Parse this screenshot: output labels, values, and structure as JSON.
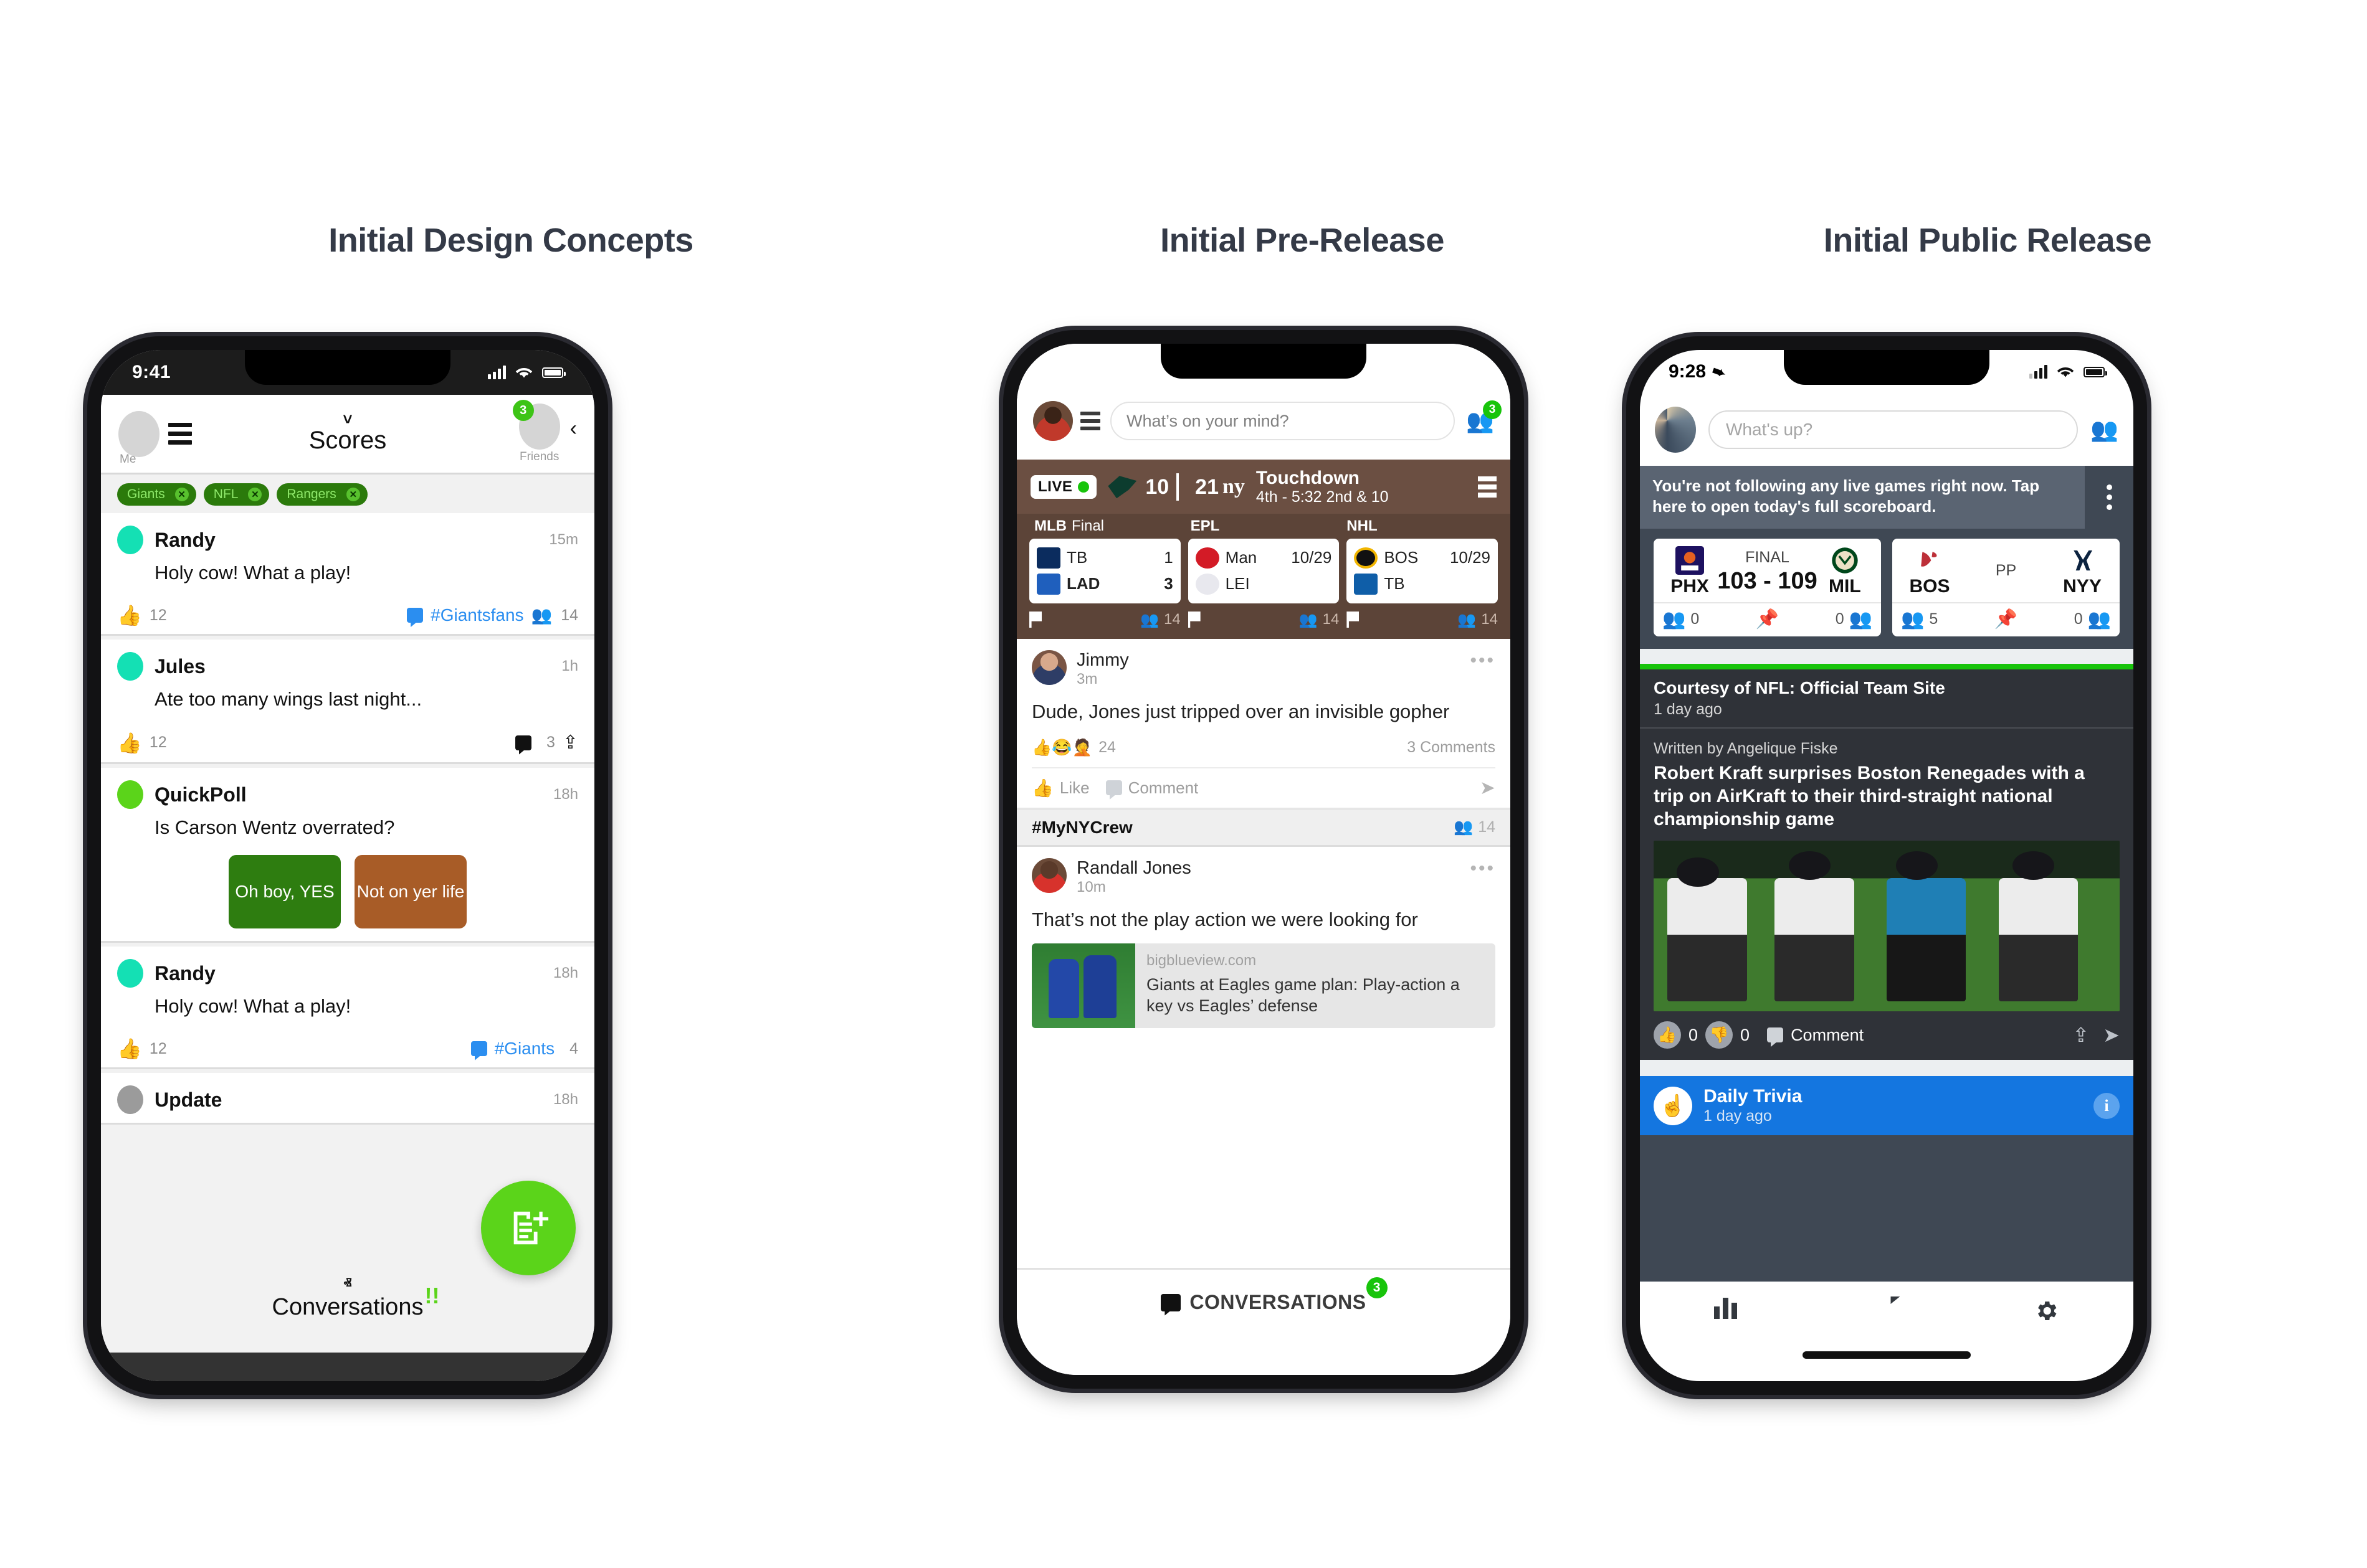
{
  "columns": [
    {
      "title": "Initial Design Concepts"
    },
    {
      "title": "Initial Pre-Release"
    },
    {
      "title": "Initial Public Release"
    }
  ],
  "phone1": {
    "status": {
      "time": "9:41"
    },
    "nav": {
      "me_label": "Me",
      "title": "Scores",
      "friends_label": "Friends",
      "friends_badge": "3",
      "chevron_down": "˅",
      "back_chevron": "‹"
    },
    "chips": [
      {
        "label": "Giants",
        "close": "✕"
      },
      {
        "label": "NFL",
        "close": "✕"
      },
      {
        "label": "Rangers",
        "close": "✕"
      }
    ],
    "feed": [
      {
        "name": "Randy",
        "time": "15m",
        "text": "Holy cow! What a play!",
        "likes": "12",
        "hashtag": "#Giantsfans",
        "people": "14"
      },
      {
        "name": "Jules",
        "time": "1h",
        "text": "Ate too many wings last night...",
        "likes": "12",
        "comments": "3"
      },
      {
        "name": "QuickPoll",
        "time": "18h",
        "text": "Is Carson Wentz overrated?",
        "option_yes": "Oh boy, YES",
        "option_no": "Not on yer life"
      },
      {
        "name": "Randy",
        "time": "18h",
        "text": "Holy cow! What a play!",
        "likes": "12",
        "hashtag": "#Giants",
        "people": "4"
      },
      {
        "name": "Update",
        "time": "18h"
      }
    ],
    "bottom": {
      "caret": "ⱏ",
      "label": "Conversations",
      "bang": "!!"
    },
    "fab_icon": "compose-icon"
  },
  "phone2": {
    "header": {
      "placeholder": "What’s on your mind?",
      "friends_badge": "3"
    },
    "live": {
      "pill": "LIVE",
      "away_score": "10",
      "home_score": "21",
      "home_logo": "ny",
      "event": "Touchdown",
      "detail": "4th - 5:32  2nd & 10"
    },
    "leagues": [
      {
        "name": "MLB",
        "status": "Final"
      },
      {
        "name": "EPL",
        "status": ""
      },
      {
        "name": "NHL",
        "status": ""
      }
    ],
    "score_cards": [
      {
        "teams": [
          {
            "abbr": "TB",
            "value": "1",
            "bold": false
          },
          {
            "abbr": "LAD",
            "value": "3",
            "bold": true
          }
        ],
        "people": "14"
      },
      {
        "teams": [
          {
            "abbr": "Man",
            "value": "10/29",
            "bold": false
          },
          {
            "abbr": "LEI",
            "value": "",
            "bold": false
          }
        ],
        "people": "14"
      },
      {
        "teams": [
          {
            "abbr": "BOS",
            "value": "10/29",
            "bold": false
          },
          {
            "abbr": "TB",
            "value": "",
            "bold": false
          }
        ],
        "people": "14"
      }
    ],
    "post1": {
      "name": "Jimmy",
      "time": "3m",
      "text": "Dude, Jones just tripped over an invisible gopher",
      "reactions": "👍😂🤦",
      "reaction_count": "24",
      "comments": "3 Comments",
      "like_label": "Like",
      "comment_label": "Comment",
      "more": "•••"
    },
    "crew": {
      "hashtag": "#MyNYCrew",
      "people": "14"
    },
    "post2": {
      "name": "Randall Jones",
      "time": "10m",
      "text": "That’s not the play action we were looking for",
      "link_domain": "bigblueview.com",
      "link_title": "Giants at Eagles game plan: Play-action a key vs Eagles’ defense",
      "more": "•••"
    },
    "bottom": {
      "label": "CONVERSATIONS",
      "badge": "3"
    }
  },
  "phone3": {
    "status": {
      "time": "9:28"
    },
    "header": {
      "placeholder": "What's up?"
    },
    "banner": {
      "text": "You're not following any live games right now. Tap here to open today's full scoreboard."
    },
    "score_cards": [
      {
        "away_abbr": "PHX",
        "home_abbr": "MIL",
        "status": "FINAL",
        "score": "103 - 109",
        "away_followers": "0",
        "home_followers": "0",
        "away_follow_active": false,
        "home_follow_active": false
      },
      {
        "away_abbr": "BOS",
        "home_abbr": "NYY",
        "status": "PP",
        "score": "",
        "away_followers": "5",
        "home_followers": "0",
        "away_follow_active": true,
        "home_follow_active": false
      }
    ],
    "article": {
      "source": "Courtesy of NFL: Official Team Site",
      "source_time": "1 day ago",
      "byline": "Written by Angelique Fiske",
      "headline": "Robert Kraft surprises Boston Renegades with a trip on AirKraft to their third-straight national championship game",
      "likes": "0",
      "dislikes": "0",
      "comment_label": "Comment"
    },
    "trivia": {
      "title": "Daily Trivia",
      "time": "1 day ago",
      "info": "i"
    },
    "tabs": [
      {
        "name": "stats-icon"
      },
      {
        "name": "conversations-icon"
      },
      {
        "name": "settings-icon"
      }
    ]
  },
  "colors": {
    "accent_green": "#5bd41a",
    "brand_blue": "#1476e0",
    "live_brown": "#6b4f42",
    "dark_slate": "#3f4854"
  }
}
